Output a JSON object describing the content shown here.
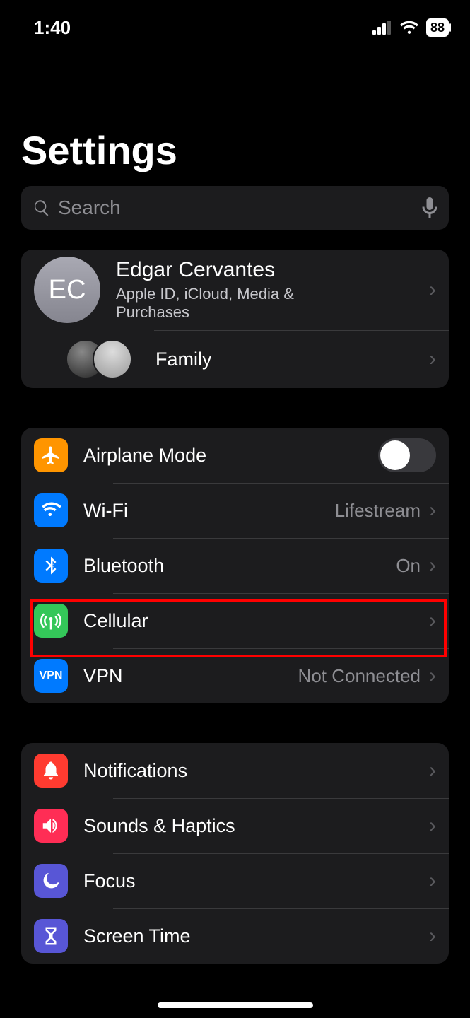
{
  "status": {
    "time": "1:40",
    "battery": "88"
  },
  "title": "Settings",
  "search": {
    "placeholder": "Search"
  },
  "profile": {
    "initials": "EC",
    "name": "Edgar Cervantes",
    "subtitle": "Apple ID, iCloud, Media & Purchases",
    "family_label": "Family"
  },
  "network": {
    "airplane": "Airplane Mode",
    "wifi_label": "Wi-Fi",
    "wifi_value": "Lifestream",
    "bluetooth_label": "Bluetooth",
    "bluetooth_value": "On",
    "cellular_label": "Cellular",
    "vpn_label": "VPN",
    "vpn_value": "Not Connected",
    "vpn_icon_text": "VPN"
  },
  "general": {
    "notifications": "Notifications",
    "sounds": "Sounds & Haptics",
    "focus": "Focus",
    "screentime": "Screen Time"
  }
}
